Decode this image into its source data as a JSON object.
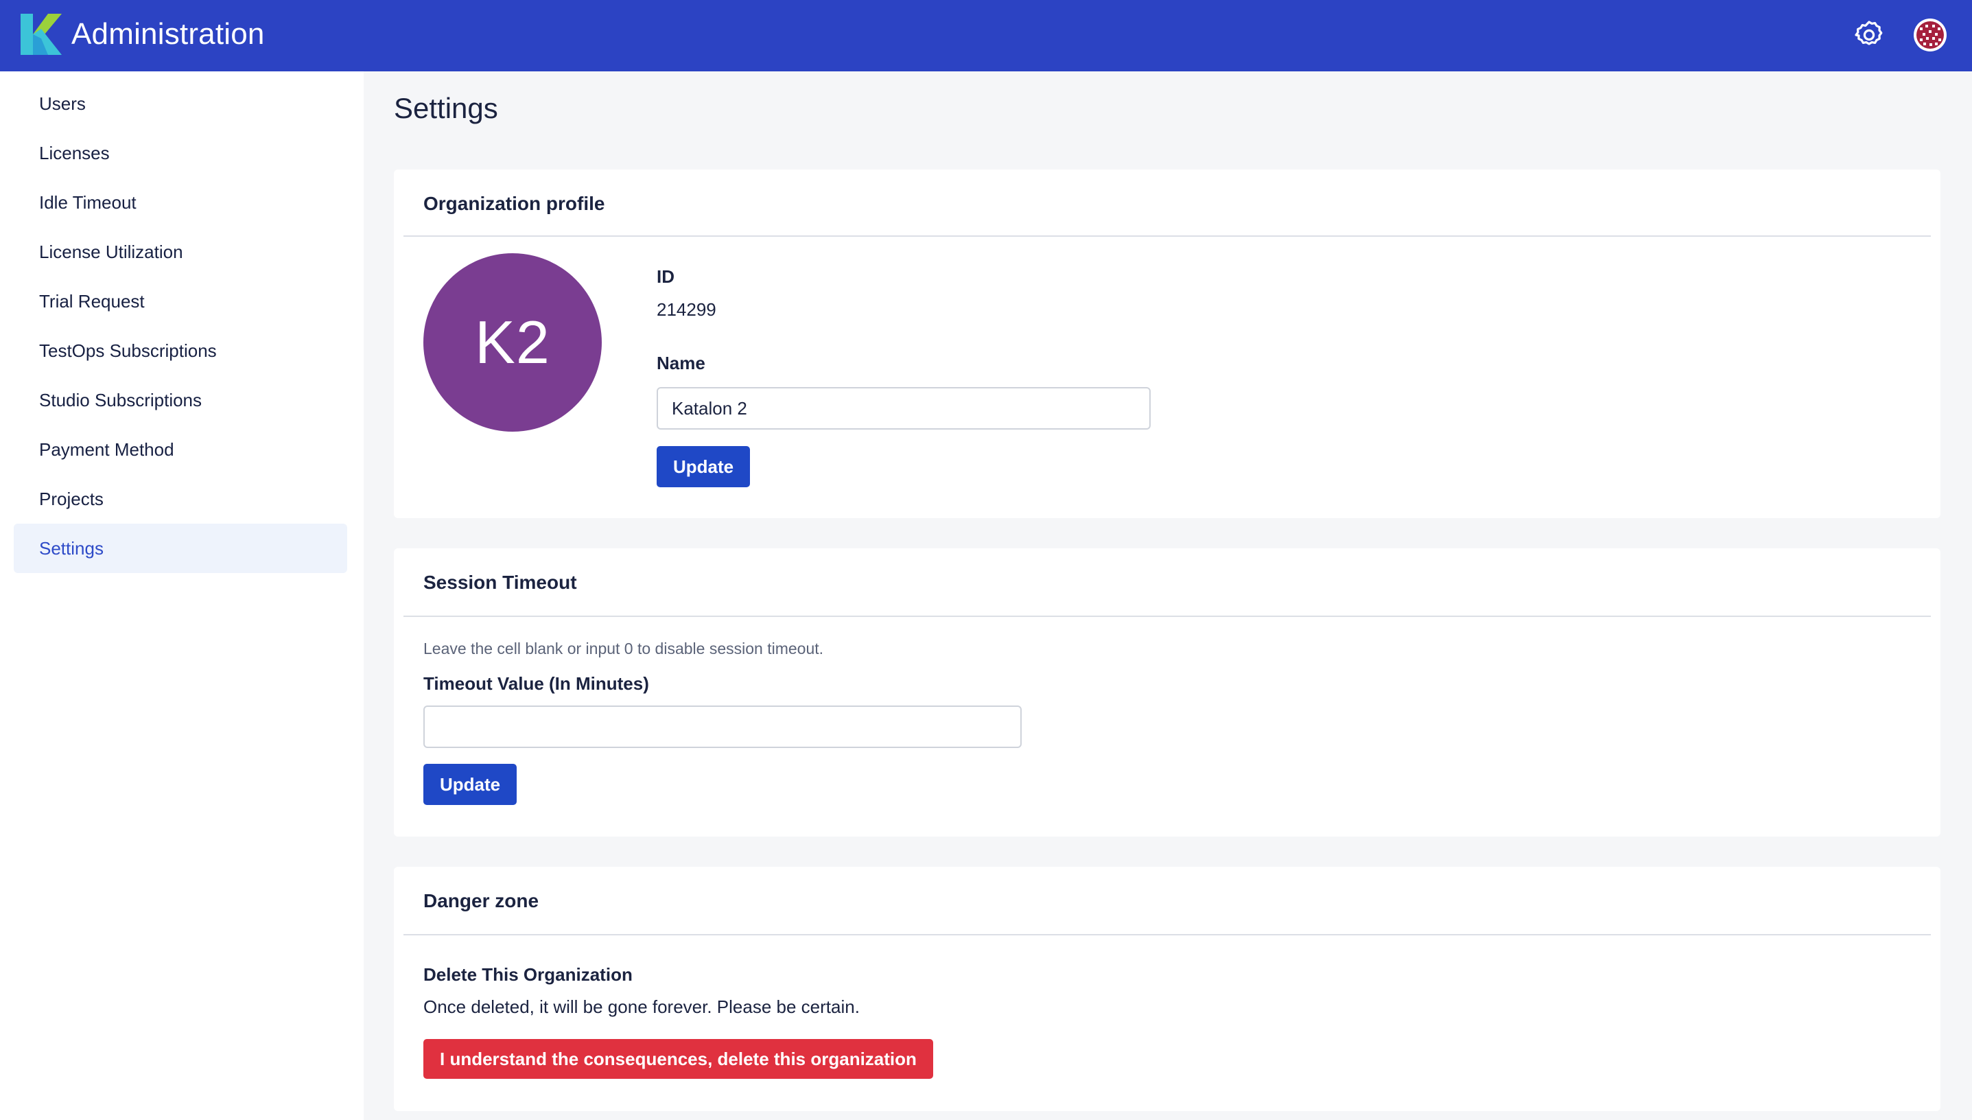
{
  "header": {
    "app_title": "Administration",
    "brand_color": "#2c43c3",
    "icons": [
      "katalon-logo",
      "gear-icon",
      "user-avatar-icon"
    ]
  },
  "sidebar": {
    "items": [
      {
        "label": "Users",
        "active": false
      },
      {
        "label": "Licenses",
        "active": false
      },
      {
        "label": "Idle Timeout",
        "active": false
      },
      {
        "label": "License Utilization",
        "active": false
      },
      {
        "label": "Trial Request",
        "active": false
      },
      {
        "label": "TestOps Subscriptions",
        "active": false
      },
      {
        "label": "Studio Subscriptions",
        "active": false
      },
      {
        "label": "Payment Method",
        "active": false
      },
      {
        "label": "Projects",
        "active": false
      },
      {
        "label": "Settings",
        "active": true
      }
    ]
  },
  "main": {
    "page_title": "Settings",
    "org_profile": {
      "title": "Organization profile",
      "avatar_initials": "K2",
      "avatar_color": "#7a3d91",
      "id_label": "ID",
      "id_value": "214299",
      "name_label": "Name",
      "name_value": "Katalon 2",
      "update_label": "Update"
    },
    "session_timeout": {
      "title": "Session Timeout",
      "hint": "Leave the cell blank or input 0 to disable session timeout.",
      "field_label": "Timeout Value (In Minutes)",
      "field_value": "",
      "update_label": "Update"
    },
    "danger_zone": {
      "title": "Danger zone",
      "heading": "Delete This Organization",
      "description": "Once deleted, it will be gone forever. Please be certain.",
      "delete_label": "I understand the consequences, delete this organization",
      "danger_color": "#e0313f"
    }
  }
}
